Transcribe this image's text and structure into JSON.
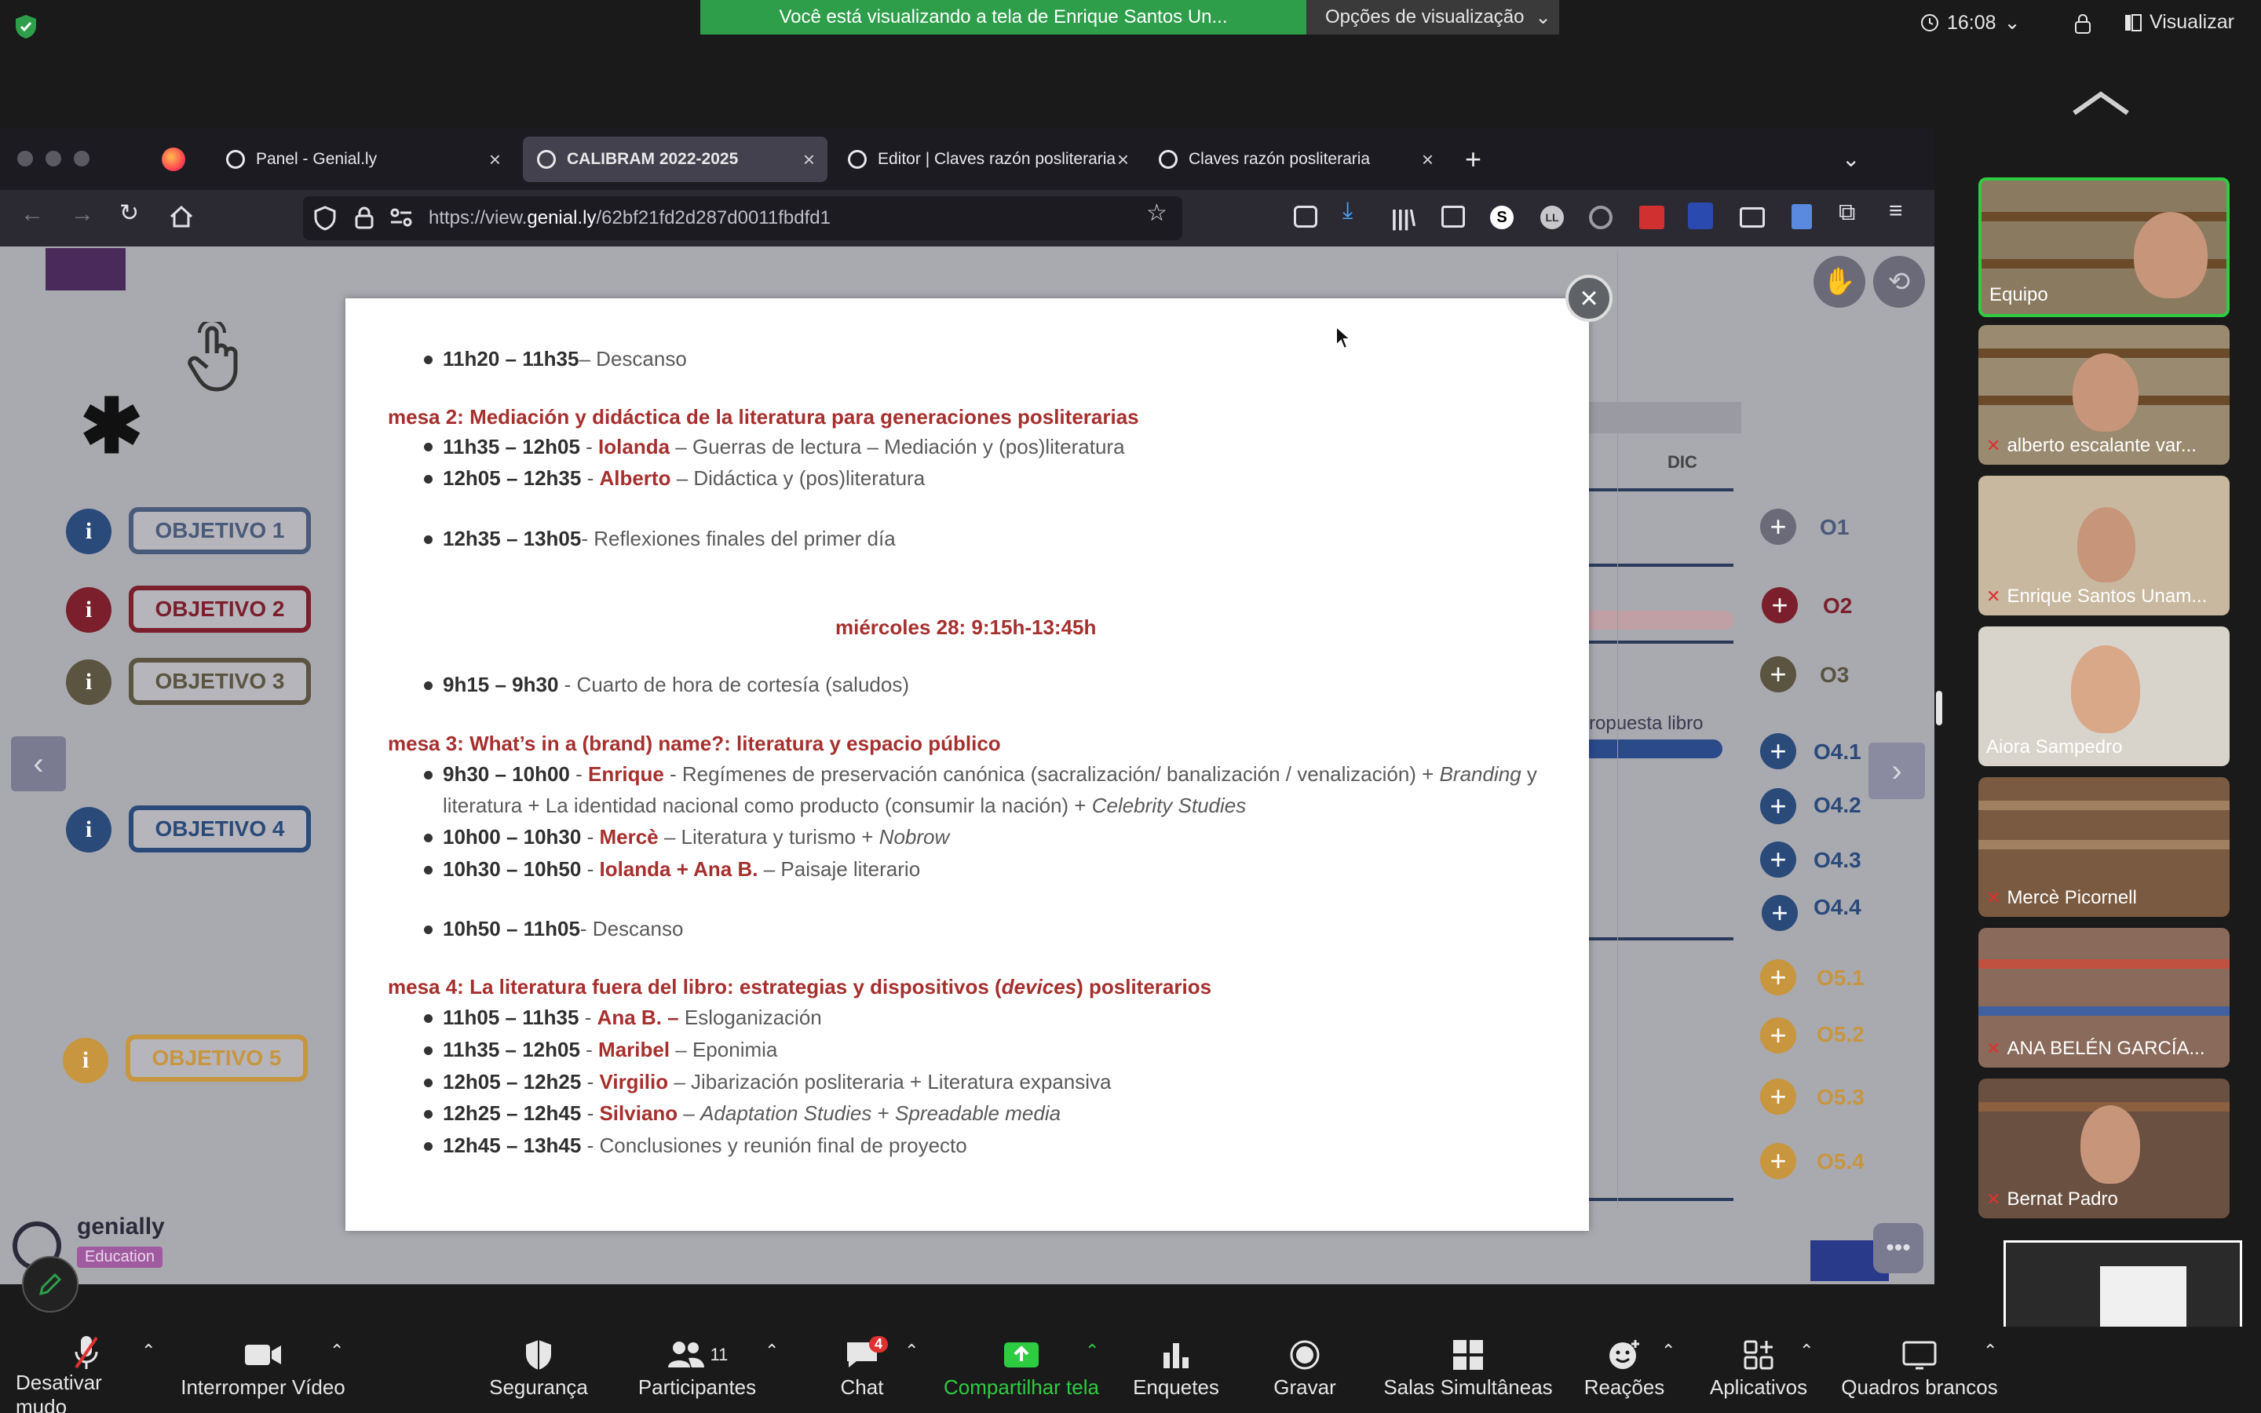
{
  "zoom": {
    "share_banner": "Você está visualizando a tela de Enrique Santos Un...",
    "view_options": "Opções de visualização",
    "clock": "16:08",
    "visualizar": "Visualizar",
    "toolbar": {
      "mute": "Desativar mudo",
      "video": "Interromper Vídeo",
      "security": "Segurança",
      "participants": "Participantes",
      "participants_count": "11",
      "chat": "Chat",
      "chat_badge": "4",
      "share": "Compartilhar tela",
      "polls": "Enquetes",
      "record": "Gravar",
      "breakout": "Salas Simultâneas",
      "reactions": "Reações",
      "apps": "Aplicativos",
      "whiteboards": "Quadros brancos"
    },
    "participants_list": [
      {
        "name": "Equipo"
      },
      {
        "name": "alberto escalante var..."
      },
      {
        "name": "Enrique Santos Unam..."
      },
      {
        "name": "Aiora Sampedro"
      },
      {
        "name": "Mercè Picornell"
      },
      {
        "name": "ANA BELÉN GARCÍA..."
      },
      {
        "name": "Bernat Padro"
      }
    ]
  },
  "browser": {
    "tabs": [
      {
        "label": "Panel - Genial.ly"
      },
      {
        "label": "CALIBRAM 2022-2025"
      },
      {
        "label": "Editor | Claves razón posliteraria"
      },
      {
        "label": "Claves razón posliteraria"
      }
    ],
    "url_prefix": "https://view.",
    "url_domain": "genial.ly",
    "url_path": "/62bf21fd2d287d0011fbdfd1"
  },
  "page": {
    "objectives": [
      "OBJETIVO 1",
      "OBJETIVO 2",
      "OBJETIVO 3",
      "OBJETIVO 4",
      "OBJETIVO 5"
    ],
    "info_glyph": "i",
    "month": "DIC",
    "propuesta": "ropuesta libro",
    "o_labels": [
      "O1",
      "O2",
      "O3",
      "O4.1",
      "O4.2",
      "O4.3",
      "O4.4",
      "O5.1",
      "O5.2",
      "O5.3",
      "O5.4"
    ],
    "brand": "genially",
    "brand_sub": "Education"
  },
  "modal": {
    "l1_time": "11h20 – 11h35",
    "l1_text": "– Descanso",
    "mesa2": "mesa 2: Mediación y didáctica de la literatura para generaciones posliterarias",
    "m2a_time": "11h35 – 12h05",
    "m2a_sep": " - ",
    "m2a_name": "Iolanda",
    "m2a_text": " – Guerras de lectura – Mediación y (pos)literatura",
    "m2b_time": "12h05 – 12h35",
    "m2b_sep": " - ",
    "m2b_name": "Alberto",
    "m2b_text": " – Didáctica y (pos)literatura",
    "l2_time": "12h35 – 13h05",
    "l2_text": "- Reflexiones finales del primer día",
    "day2": "miércoles 28: 9:15h-13:45h",
    "l3_time": "9h15 – 9h30",
    "l3_text": " - Cuarto de hora de cortesía (saludos)",
    "mesa3": "mesa 3: What’s in a (brand) name?: literatura y espacio público",
    "m3a_time": "9h30 – 10h00",
    "m3a_sep": " - ",
    "m3a_name": "Enrique",
    "m3a_text1": " - Regímenes de preservación canónica (sacralización/ banalización / venalización) + ",
    "m3a_it1": "Branding",
    "m3a_text2": " y",
    "m3a_line2a": "literatura + La identidad nacional como producto (consumir la nación) + ",
    "m3a_it2": "Celebrity Studies",
    "m3b_time": "10h00 – 10h30",
    "m3b_sep": " - ",
    "m3b_name": "Mercè",
    "m3b_text": " – Literatura y turismo + ",
    "m3b_it": "Nobrow",
    "m3c_time": "10h30 – 10h50",
    "m3c_sep": " - ",
    "m3c_name": "Iolanda + Ana B.",
    "m3c_text": " – Paisaje literario",
    "l4_time": "10h50 – 11h05",
    "l4_text": "- Descanso",
    "mesa4a": "mesa 4: La literatura fuera del libro: estrategias y dispositivos (",
    "mesa4it": "devices",
    "mesa4b": ") posliterarios",
    "m4a_time": "11h05 – 11h35",
    "m4a_sep": " - ",
    "m4a_name": "Ana B. –",
    "m4a_text": " Esloganización",
    "m4b_time": "11h35 – 12h05",
    "m4b_sep": " - ",
    "m4b_name": "Maribel",
    "m4b_text": " – Eponimia",
    "m4c_time": "12h05 – 12h25",
    "m4c_sep": " - ",
    "m4c_name": "Virgilio",
    "m4c_text": " – Jibarización posliteraria + Literatura expansiva",
    "m4d_time": "12h25 – 12h45",
    "m4d_sep": " - ",
    "m4d_name": "Silviano",
    "m4d_dash": " – ",
    "m4d_it": "Adaptation Studies",
    "m4d_plus": " + ",
    "m4d_it2": "Spreadable media",
    "m4e_time": "12h45 – 13h45",
    "m4e_text": " - Conclusiones y reunión final de proyecto"
  },
  "colors": {
    "accent_red": "#a5302e",
    "zoom_green": "#2e9e4b",
    "obj_blue": "#2a4a7a",
    "obj_red": "#7a1f2b",
    "obj_olive": "#5a5440",
    "obj_gold": "#d8a84a"
  }
}
